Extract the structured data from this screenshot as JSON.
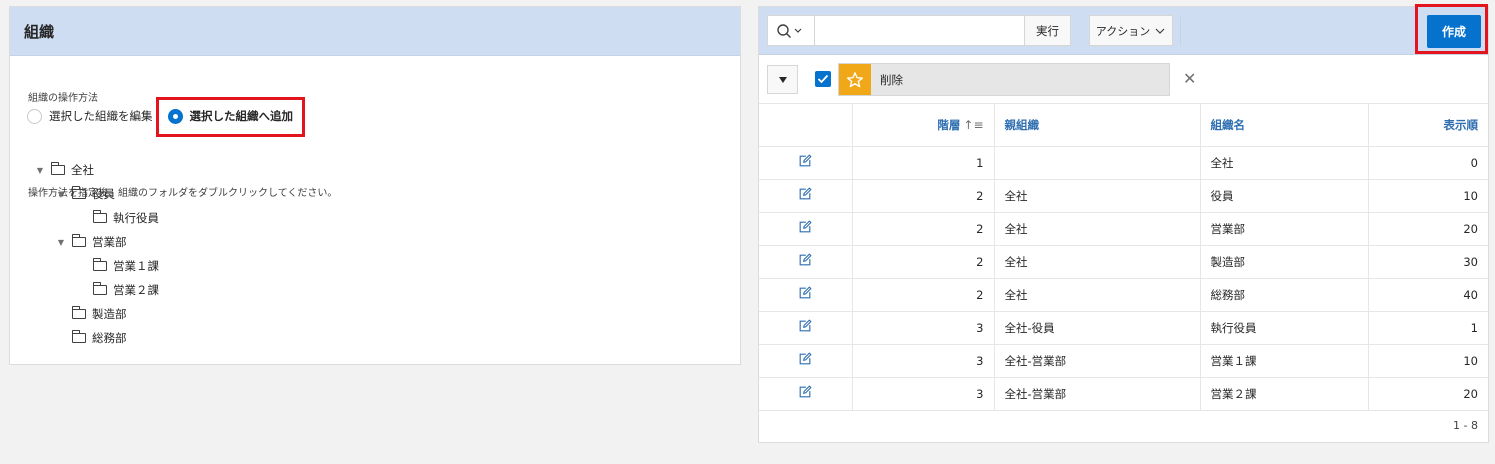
{
  "left": {
    "title": "組織",
    "operation_label": "組織の操作方法",
    "radios": [
      {
        "label": "選択した組織を編集",
        "selected": false
      },
      {
        "label": "選択した組織へ追加",
        "selected": true
      }
    ],
    "hint": "操作方法を指定後、組織のフォルダをダブルクリックしてください。",
    "tree": [
      {
        "label": "全社",
        "depth": 0,
        "expanded": true
      },
      {
        "label": "役員",
        "depth": 1,
        "expanded": true
      },
      {
        "label": "執行役員",
        "depth": 2,
        "expanded": null
      },
      {
        "label": "営業部",
        "depth": 1,
        "expanded": true
      },
      {
        "label": "営業１課",
        "depth": 2,
        "expanded": null
      },
      {
        "label": "営業２課",
        "depth": 2,
        "expanded": null
      },
      {
        "label": "製造部",
        "depth": 1,
        "expanded": null
      },
      {
        "label": "総務部",
        "depth": 1,
        "expanded": null
      }
    ]
  },
  "right": {
    "toolbar": {
      "search_value": "",
      "go_label": "実行",
      "actions_label": "アクション",
      "create_label": "作成"
    },
    "filter": {
      "label": "削除",
      "checked": true
    },
    "columns": {
      "level": "階層",
      "parent": "親組織",
      "name": "組織名",
      "order": "表示順"
    },
    "rows": [
      {
        "level": "1",
        "parent": "",
        "name": "全社",
        "order": "0"
      },
      {
        "level": "2",
        "parent": "全社",
        "name": "役員",
        "order": "10"
      },
      {
        "level": "2",
        "parent": "全社",
        "name": "営業部",
        "order": "20"
      },
      {
        "level": "2",
        "parent": "全社",
        "name": "製造部",
        "order": "30"
      },
      {
        "level": "2",
        "parent": "全社",
        "name": "総務部",
        "order": "40"
      },
      {
        "level": "3",
        "parent": "全社-役員",
        "name": "執行役員",
        "order": "1"
      },
      {
        "level": "3",
        "parent": "全社-営業部",
        "name": "営業１課",
        "order": "10"
      },
      {
        "level": "3",
        "parent": "全社-営業部",
        "name": "営業２課",
        "order": "20"
      }
    ],
    "pagination": "1 - 8"
  },
  "colors": {
    "header_bg": "#cfddf3",
    "accent": "#0572ce",
    "highlight": "#e3141e",
    "star": "#f0a818",
    "link": "#2f6fb1"
  }
}
